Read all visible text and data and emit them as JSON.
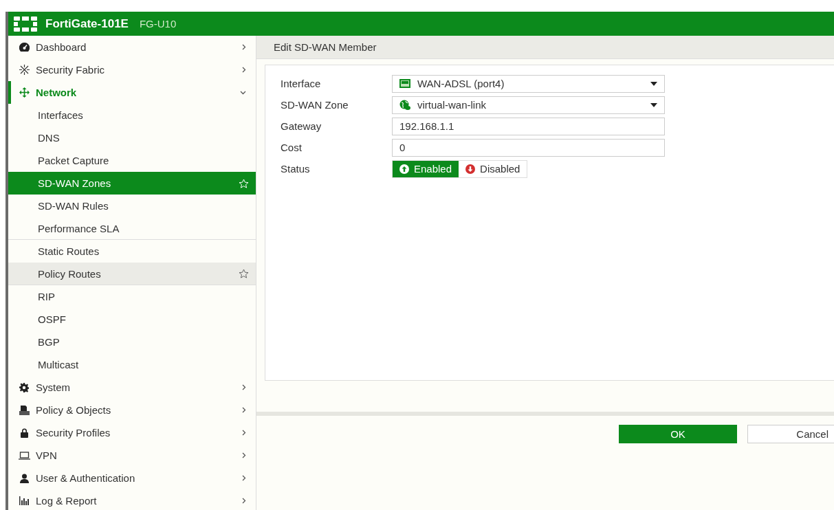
{
  "header": {
    "product": "FortiGate-101E",
    "hostname": "FG-U10"
  },
  "sidebar": {
    "items": [
      {
        "label": "Dashboard",
        "expanded": false
      },
      {
        "label": "Security Fabric",
        "expanded": false
      },
      {
        "label": "Network",
        "expanded": true,
        "children": [
          {
            "label": "Interfaces",
            "selected": false,
            "hovered": false,
            "separator_after": false
          },
          {
            "label": "DNS",
            "selected": false,
            "hovered": false,
            "separator_after": false
          },
          {
            "label": "Packet Capture",
            "selected": false,
            "hovered": false,
            "separator_after": false
          },
          {
            "label": "SD-WAN Zones",
            "selected": true,
            "hovered": false,
            "separator_after": false
          },
          {
            "label": "SD-WAN Rules",
            "selected": false,
            "hovered": false,
            "separator_after": false
          },
          {
            "label": "Performance SLA",
            "selected": false,
            "hovered": false,
            "separator_after": true
          },
          {
            "label": "Static Routes",
            "selected": false,
            "hovered": false,
            "separator_after": false
          },
          {
            "label": "Policy Routes",
            "selected": false,
            "hovered": true,
            "separator_after": true
          },
          {
            "label": "RIP",
            "selected": false,
            "hovered": false,
            "separator_after": false
          },
          {
            "label": "OSPF",
            "selected": false,
            "hovered": false,
            "separator_after": false
          },
          {
            "label": "BGP",
            "selected": false,
            "hovered": false,
            "separator_after": false
          },
          {
            "label": "Multicast",
            "selected": false,
            "hovered": false,
            "separator_after": false
          }
        ]
      },
      {
        "label": "System",
        "expanded": false
      },
      {
        "label": "Policy & Objects",
        "expanded": false
      },
      {
        "label": "Security Profiles",
        "expanded": false
      },
      {
        "label": "VPN",
        "expanded": false
      },
      {
        "label": "User & Authentication",
        "expanded": false
      },
      {
        "label": "Log & Report",
        "expanded": false
      }
    ]
  },
  "form": {
    "title": "Edit SD-WAN Member",
    "fields": [
      {
        "kind": "select",
        "label": "Interface",
        "value": "WAN-ADSL (port4)"
      },
      {
        "kind": "select",
        "label": "SD-WAN Zone",
        "value": "virtual-wan-link"
      },
      {
        "kind": "text",
        "label": "Gateway",
        "value": "192.168.1.1"
      },
      {
        "kind": "text",
        "label": "Cost",
        "value": "0"
      },
      {
        "kind": "toggle",
        "label": "Status",
        "options": [
          {
            "label": "Enabled",
            "selected": true
          },
          {
            "label": "Disabled",
            "selected": false
          }
        ]
      }
    ]
  },
  "buttons": [
    {
      "kind": "primary",
      "label": "OK"
    },
    {
      "kind": "secondary",
      "label": "Cancel"
    }
  ]
}
